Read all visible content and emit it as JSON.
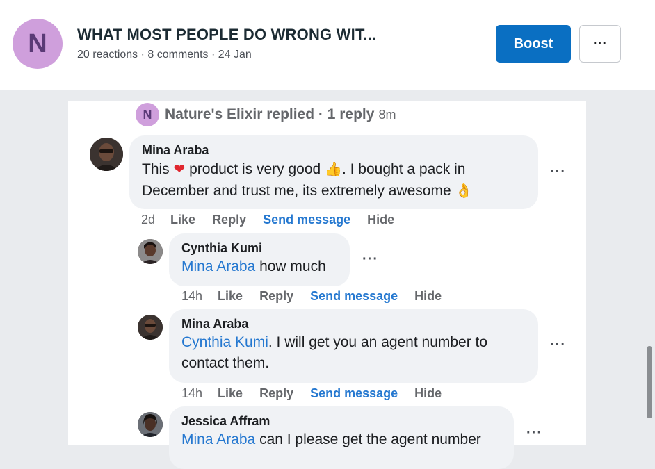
{
  "header": {
    "avatar_letter": "N",
    "title": "WHAT MOST PEOPLE DO WRONG WIT...",
    "meta": "20 reactions · 8 comments · 24 Jan",
    "boost_label": "Boost",
    "more_label": "···"
  },
  "replied": {
    "avatar_letter": "N",
    "text": "Nature's Elixir replied · 1 reply",
    "time": "8m"
  },
  "comments": [
    {
      "author": "Mina Araba",
      "text_parts": [
        "This ",
        "❤",
        " product is very good ",
        "👍",
        ". I bought a pack in December and trust me, its extremely awesome ",
        "👌"
      ],
      "time": "2d",
      "like": "Like",
      "reply": "Reply",
      "send": "Send message",
      "hide": "Hide",
      "more": "···"
    },
    {
      "author": "Cynthia Kumi",
      "mention": "Mina Araba",
      "text": " how much",
      "time": "14h",
      "like": "Like",
      "reply": "Reply",
      "send": "Send message",
      "hide": "Hide",
      "more": "···"
    },
    {
      "author": "Mina Araba",
      "mention": "Cynthia Kumi",
      "text": ". I will get you an agent number to contact them.",
      "time": "14h",
      "like": "Like",
      "reply": "Reply",
      "send": "Send message",
      "hide": "Hide",
      "more": "···"
    },
    {
      "author": "Jessica Affram",
      "mention": "Mina Araba",
      "text": " can I please get the agent number",
      "more": "···"
    }
  ],
  "icons": {
    "more": "more-horizontal-icon",
    "heart": "red-heart-emoji",
    "thumb": "thumbs-up-emoji",
    "ok": "ok-hand-emoji"
  },
  "colors": {
    "boost": "#0a6fc2",
    "mention": "#2578d0",
    "page_avatar": "#cf9fdc"
  }
}
